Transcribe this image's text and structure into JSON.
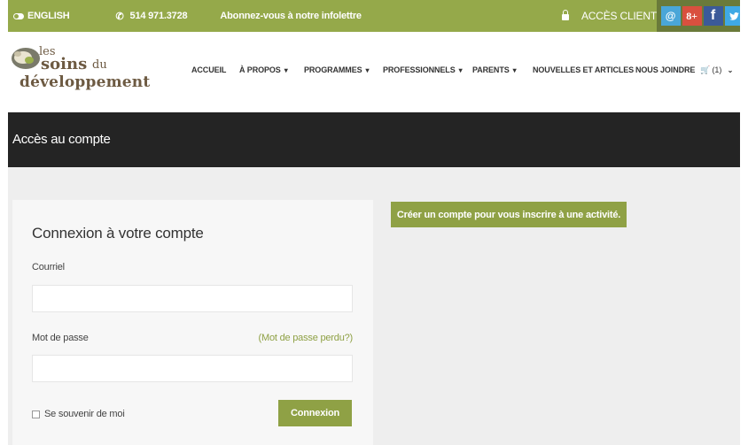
{
  "topbar": {
    "language": "ENGLISH",
    "phone": "514 971.3728",
    "newsletter": "Abonnez-vous à notre infolettre",
    "client_access": "ACCÈS CLIENT",
    "social": {
      "email_glyph": "@",
      "gplus_glyph": "8+",
      "facebook_glyph": "f",
      "twitter_glyph": "🐦"
    },
    "color": "#95a94a"
  },
  "logo": {
    "line1": "les",
    "line2": "soins",
    "line2b": "du",
    "line3": "développement"
  },
  "nav": {
    "items": [
      {
        "label": "ACCUEIL"
      },
      {
        "label": "À PROPOS",
        "caret": "▾"
      },
      {
        "label": "PROGRAMMES",
        "caret": "▾"
      },
      {
        "label": "PROFESSIONNELS",
        "caret": "▾"
      },
      {
        "label": "PARENTS",
        "caret": "▾"
      },
      {
        "label": "NOUVELLES ET ARTICLES"
      },
      {
        "label": "NOUS JOINDRE"
      }
    ],
    "cart": {
      "icon": "cart-icon",
      "label": "(1)",
      "caret": "⌄"
    }
  },
  "banner": {
    "title": "Accès au compte"
  },
  "login": {
    "title": "Connexion à votre compte",
    "email_label": "Courriel",
    "email_value": "",
    "password_label": "Mot de passe",
    "password_value": "",
    "lost_password": "(Mot de passe perdu?)",
    "remember_label": "Se souvenir de moi",
    "submit_label": "Connexion"
  },
  "signup": {
    "label": "Créer un compte pour vous inscrire à une activité."
  },
  "colors": {
    "accent": "#8fa145",
    "banner": "#242424",
    "background": "#eeeeee"
  }
}
